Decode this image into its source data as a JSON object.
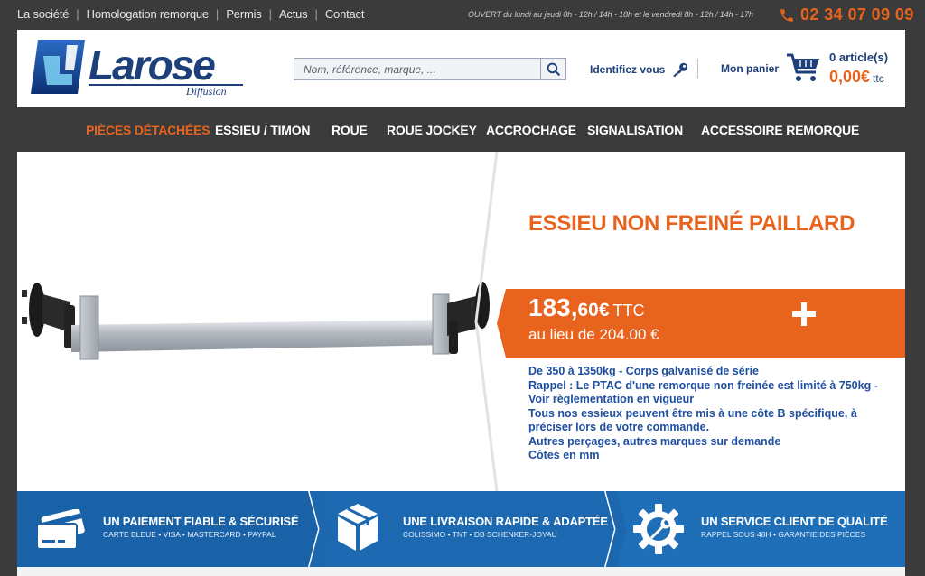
{
  "topbar": {
    "links": [
      "La société",
      "Homologation remorque",
      "Permis",
      "Actus",
      "Contact"
    ],
    "hours": "OUVERT du lundi au jeudi 8h - 12h / 14h - 18h et le vendredi 8h - 12h / 14h - 17h",
    "phone": "02 34 07 09 09"
  },
  "header": {
    "logo_text": "Larose",
    "logo_subtext": "Diffusion",
    "search_placeholder": "Nom, référence, marque, ...",
    "login_label": "Identifiez vous",
    "cart_label": "Mon panier",
    "cart_count": "0 article(s)",
    "cart_total": "0,00€",
    "cart_total_suffix": "ttc"
  },
  "nav": {
    "items": [
      "PIÈCES DÉTACHÉES",
      "ESSIEU / TIMON",
      "ROUE",
      "ROUE JOCKEY",
      "ACCROCHAGE",
      "SIGNALISATION",
      "ACCESSOIRE REMORQUE"
    ],
    "active_index": 0
  },
  "product": {
    "title": "ESSIEU NON FREINÉ PAILLARD",
    "price_main": "183,",
    "price_cents": "60€",
    "price_suffix": "TTC",
    "old_price": "au lieu de 204.00 €",
    "description": [
      "De 350 à 1350kg - Corps galvanisé de série",
      "Rappel : Le PTAC d'une remorque non freinée est limité à 750kg -",
      "Voir règlementation en vigueur",
      "Tous nos essieux peuvent être mis à une côte B spécifique, à",
      "préciser lors de votre commande.",
      "Autres perçages, autres marques sur demande",
      "Côtes en mm"
    ]
  },
  "features": [
    {
      "title": "UN PAIEMENT FIABLE & SÉCURISÉ",
      "subtitle": "CARTE BLEUE • VISA • MASTERCARD • PAYPAL",
      "icon": "credit-card-icon"
    },
    {
      "title": "UNE LIVRAISON RAPIDE & ADAPTÉE",
      "subtitle": "COLISSIMO • TNT • DB SCHENKER-JOYAU",
      "icon": "package-icon"
    },
    {
      "title": "UN SERVICE CLIENT DE QUALITÉ",
      "subtitle": "RAPPEL SOUS 48H • GARANTIE DES PIÈCES",
      "icon": "gear-wrench-icon"
    }
  ],
  "colors": {
    "accent": "#e8641e",
    "brand_blue": "#1d3f7a",
    "dark": "#3a3a3a",
    "band_blue": "#1c67ae"
  }
}
